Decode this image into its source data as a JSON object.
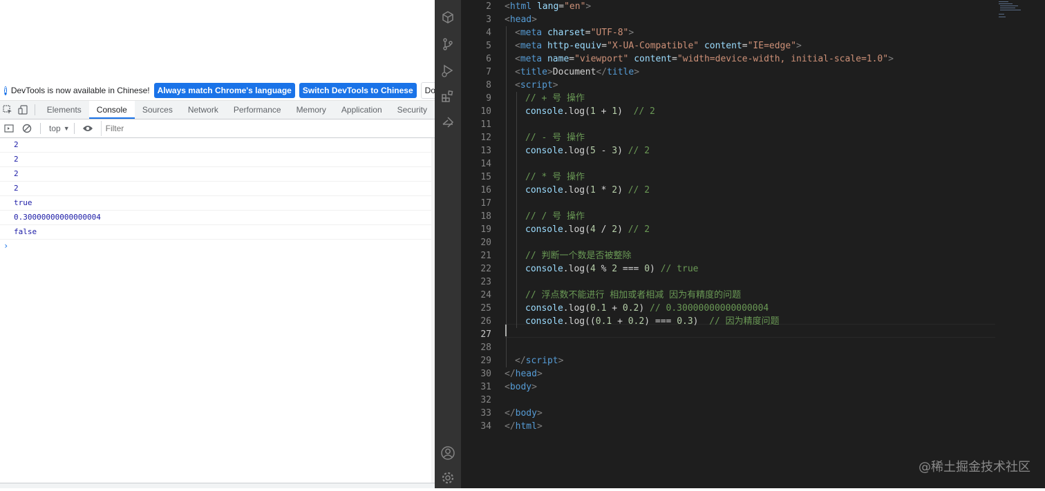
{
  "devtools": {
    "infobar": {
      "message": "DevTools is now available in Chinese!",
      "match_button": "Always match Chrome's language",
      "switch_button": "Switch DevTools to Chinese",
      "dont_show_button": "Don't show"
    },
    "tabs": [
      "Elements",
      "Console",
      "Sources",
      "Network",
      "Performance",
      "Memory",
      "Application",
      "Security"
    ],
    "active_tab": "Console",
    "toolbar": {
      "context": "top",
      "filter_placeholder": "Filter"
    },
    "console_lines": [
      "2",
      "2",
      "2",
      "2",
      "true",
      "0.30000000000000004",
      "false"
    ],
    "prompt_symbol": "›"
  },
  "editor": {
    "current_line": 27,
    "watermark": "@稀土掘金技术社区",
    "lines": [
      {
        "num": 2,
        "indent": 0,
        "tokens": [
          [
            "p",
            "<"
          ],
          [
            "t",
            "html"
          ],
          [
            "tx",
            " "
          ],
          [
            "a",
            "lang"
          ],
          [
            "tx",
            "="
          ],
          [
            "s",
            "\"en\""
          ],
          [
            "p",
            ">"
          ]
        ]
      },
      {
        "num": 3,
        "indent": 0,
        "tokens": [
          [
            "p",
            "<"
          ],
          [
            "t",
            "head"
          ],
          [
            "p",
            ">"
          ]
        ]
      },
      {
        "num": 4,
        "indent": 1,
        "tokens": [
          [
            "p",
            "<"
          ],
          [
            "t",
            "meta"
          ],
          [
            "tx",
            " "
          ],
          [
            "a",
            "charset"
          ],
          [
            "tx",
            "="
          ],
          [
            "s",
            "\"UTF-8\""
          ],
          [
            "p",
            ">"
          ]
        ]
      },
      {
        "num": 5,
        "indent": 1,
        "tokens": [
          [
            "p",
            "<"
          ],
          [
            "t",
            "meta"
          ],
          [
            "tx",
            " "
          ],
          [
            "a",
            "http-equiv"
          ],
          [
            "tx",
            "="
          ],
          [
            "s",
            "\"X-UA-Compatible\""
          ],
          [
            "tx",
            " "
          ],
          [
            "a",
            "content"
          ],
          [
            "tx",
            "="
          ],
          [
            "s",
            "\"IE=edge\""
          ],
          [
            "p",
            ">"
          ]
        ]
      },
      {
        "num": 6,
        "indent": 1,
        "tokens": [
          [
            "p",
            "<"
          ],
          [
            "t",
            "meta"
          ],
          [
            "tx",
            " "
          ],
          [
            "a",
            "name"
          ],
          [
            "tx",
            "="
          ],
          [
            "s",
            "\"viewport\""
          ],
          [
            "tx",
            " "
          ],
          [
            "a",
            "content"
          ],
          [
            "tx",
            "="
          ],
          [
            "s",
            "\"width=device-width, initial-scale=1.0\""
          ],
          [
            "p",
            ">"
          ]
        ]
      },
      {
        "num": 7,
        "indent": 1,
        "tokens": [
          [
            "p",
            "<"
          ],
          [
            "t",
            "title"
          ],
          [
            "p",
            ">"
          ],
          [
            "tx",
            "Document"
          ],
          [
            "p",
            "</"
          ],
          [
            "t",
            "title"
          ],
          [
            "p",
            ">"
          ]
        ]
      },
      {
        "num": 8,
        "indent": 1,
        "tokens": [
          [
            "p",
            "<"
          ],
          [
            "t",
            "script"
          ],
          [
            "p",
            ">"
          ]
        ]
      },
      {
        "num": 9,
        "indent": 2,
        "tokens": [
          [
            "c",
            "// + 号 操作"
          ]
        ]
      },
      {
        "num": 10,
        "indent": 2,
        "tokens": [
          [
            "a",
            "console"
          ],
          [
            "tx",
            "."
          ],
          [
            "tx",
            "log"
          ],
          [
            "tx",
            "("
          ],
          [
            "n",
            "1"
          ],
          [
            "tx",
            " + "
          ],
          [
            "n",
            "1"
          ],
          [
            "tx",
            ")  "
          ],
          [
            "c",
            "// 2"
          ]
        ]
      },
      {
        "num": 11,
        "indent": 2,
        "tokens": []
      },
      {
        "num": 12,
        "indent": 2,
        "tokens": [
          [
            "c",
            "// - 号 操作"
          ]
        ]
      },
      {
        "num": 13,
        "indent": 2,
        "tokens": [
          [
            "a",
            "console"
          ],
          [
            "tx",
            "."
          ],
          [
            "tx",
            "log"
          ],
          [
            "tx",
            "("
          ],
          [
            "n",
            "5"
          ],
          [
            "tx",
            " - "
          ],
          [
            "n",
            "3"
          ],
          [
            "tx",
            ") "
          ],
          [
            "c",
            "// 2"
          ]
        ]
      },
      {
        "num": 14,
        "indent": 2,
        "tokens": []
      },
      {
        "num": 15,
        "indent": 2,
        "tokens": [
          [
            "c",
            "// * 号 操作"
          ]
        ]
      },
      {
        "num": 16,
        "indent": 2,
        "tokens": [
          [
            "a",
            "console"
          ],
          [
            "tx",
            "."
          ],
          [
            "tx",
            "log"
          ],
          [
            "tx",
            "("
          ],
          [
            "n",
            "1"
          ],
          [
            "tx",
            " * "
          ],
          [
            "n",
            "2"
          ],
          [
            "tx",
            ") "
          ],
          [
            "c",
            "// 2"
          ]
        ]
      },
      {
        "num": 17,
        "indent": 2,
        "tokens": []
      },
      {
        "num": 18,
        "indent": 2,
        "tokens": [
          [
            "c",
            "// / 号 操作"
          ]
        ]
      },
      {
        "num": 19,
        "indent": 2,
        "tokens": [
          [
            "a",
            "console"
          ],
          [
            "tx",
            "."
          ],
          [
            "tx",
            "log"
          ],
          [
            "tx",
            "("
          ],
          [
            "n",
            "4"
          ],
          [
            "tx",
            " / "
          ],
          [
            "n",
            "2"
          ],
          [
            "tx",
            ") "
          ],
          [
            "c",
            "// 2"
          ]
        ]
      },
      {
        "num": 20,
        "indent": 2,
        "tokens": []
      },
      {
        "num": 21,
        "indent": 2,
        "tokens": [
          [
            "c",
            "// 判断一个数是否被整除"
          ]
        ]
      },
      {
        "num": 22,
        "indent": 2,
        "tokens": [
          [
            "a",
            "console"
          ],
          [
            "tx",
            "."
          ],
          [
            "tx",
            "log"
          ],
          [
            "tx",
            "("
          ],
          [
            "n",
            "4"
          ],
          [
            "tx",
            " % "
          ],
          [
            "n",
            "2"
          ],
          [
            "tx",
            " === "
          ],
          [
            "n",
            "0"
          ],
          [
            "tx",
            ") "
          ],
          [
            "c",
            "// true"
          ]
        ]
      },
      {
        "num": 23,
        "indent": 2,
        "tokens": []
      },
      {
        "num": 24,
        "indent": 2,
        "tokens": [
          [
            "c",
            "// 浮点数不能进行 相加或者相减 因为有精度的问题"
          ]
        ]
      },
      {
        "num": 25,
        "indent": 2,
        "tokens": [
          [
            "a",
            "console"
          ],
          [
            "tx",
            "."
          ],
          [
            "tx",
            "log"
          ],
          [
            "tx",
            "("
          ],
          [
            "n",
            "0.1"
          ],
          [
            "tx",
            " + "
          ],
          [
            "n",
            "0.2"
          ],
          [
            "tx",
            ") "
          ],
          [
            "c",
            "// 0.30000000000000004"
          ]
        ]
      },
      {
        "num": 26,
        "indent": 2,
        "tokens": [
          [
            "a",
            "console"
          ],
          [
            "tx",
            "."
          ],
          [
            "tx",
            "log"
          ],
          [
            "tx",
            "(("
          ],
          [
            "n",
            "0.1"
          ],
          [
            "tx",
            " + "
          ],
          [
            "n",
            "0.2"
          ],
          [
            "tx",
            ") === "
          ],
          [
            "n",
            "0.3"
          ],
          [
            "tx",
            ")  "
          ],
          [
            "c",
            "// 因为精度问题"
          ]
        ]
      },
      {
        "num": 27,
        "indent": 0,
        "tokens": []
      },
      {
        "num": 28,
        "indent": 0,
        "tokens": []
      },
      {
        "num": 29,
        "indent": 1,
        "tokens": [
          [
            "p",
            "</"
          ],
          [
            "t",
            "script"
          ],
          [
            "p",
            ">"
          ]
        ]
      },
      {
        "num": 30,
        "indent": 0,
        "tokens": [
          [
            "p",
            "</"
          ],
          [
            "t",
            "head"
          ],
          [
            "p",
            ">"
          ]
        ]
      },
      {
        "num": 31,
        "indent": 0,
        "tokens": [
          [
            "p",
            "<"
          ],
          [
            "t",
            "body"
          ],
          [
            "p",
            ">"
          ]
        ]
      },
      {
        "num": 32,
        "indent": 0,
        "tokens": []
      },
      {
        "num": 33,
        "indent": 0,
        "tokens": [
          [
            "p",
            "</"
          ],
          [
            "t",
            "body"
          ],
          [
            "p",
            ">"
          ]
        ]
      },
      {
        "num": 34,
        "indent": 0,
        "tokens": [
          [
            "p",
            "</"
          ],
          [
            "t",
            "html"
          ],
          [
            "p",
            ">"
          ]
        ]
      }
    ]
  },
  "icons": {
    "activity": [
      "explorer-icon",
      "source-control-icon",
      "run-debug-icon",
      "extensions-icon",
      "remote-icon"
    ],
    "bottom": [
      "account-icon",
      "settings-gear-icon"
    ]
  }
}
